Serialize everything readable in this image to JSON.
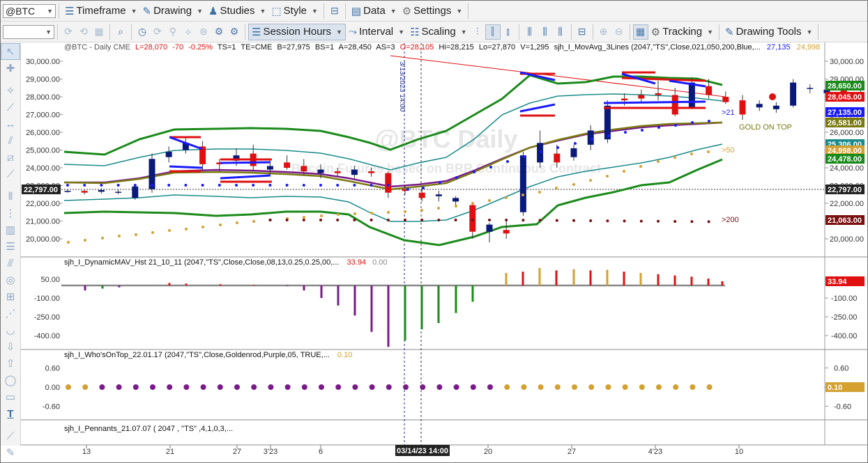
{
  "toolbar1": {
    "symbol": "@BTC",
    "timeframe": "Timeframe",
    "drawing": "Drawing",
    "studies": "Studies",
    "style": "Style",
    "data": "Data",
    "settings": "Settings"
  },
  "toolbar2": {
    "session_hours": "Session Hours",
    "interval": "Interval",
    "scaling": "Scaling",
    "tracking": "Tracking",
    "drawing_tools": "Drawing Tools"
  },
  "header": {
    "symbol_info": "@BTC - Daily  CME",
    "last": "L=28,070",
    "change": "-70",
    "pct": "-0.25%",
    "ts": "TS=1",
    "te": "TE=CME",
    "bid": "B=27,975",
    "bs": "BS=1",
    "ask": "A=28,450",
    "as": "AS=3",
    "open": "O=28,105",
    "hi": "Hi=28,215",
    "lo": "Lo=27,870",
    "vol": "V=1,295",
    "study": "sjh_I_MovAvg_3Lines (2047,\"TS\",Close,021,050,200,Blue,...",
    "val1": "27,135",
    "val2": "24,998"
  },
  "watermark": {
    "title": "@BTC Daily",
    "subtitle": "Bitcoin Futures based on BRR Continuous Contract"
  },
  "colors": {
    "up": "#0a1a7a",
    "down": "#e01010",
    "green": "#1a8a1a",
    "teal": "#1a8a8a",
    "purple": "#7a1a8a",
    "gold": "#d4a030",
    "darkred": "#7a1010",
    "blue": "#1a1aff",
    "olive": "#7a7a10"
  },
  "price_axis": {
    "ticks": [
      "30,000.00",
      "29,000.00",
      "28,000.00",
      "27,000.00",
      "26,000.00",
      "25,000.00",
      "24,000.00",
      "23,000.00",
      "22,000.00",
      "21,000.00",
      "20,000.00"
    ],
    "left_label": "22,797.00",
    "badges": [
      {
        "text": "28,650.00",
        "color": "#1a8a1a"
      },
      {
        "text": "28,045.00",
        "color": "#e01010"
      },
      {
        "text": "27,135.00",
        "color": "#1a1aff"
      },
      {
        "text": "26,581.00",
        "color": "#7a7a10"
      },
      {
        "text": "25,306.00",
        "color": "#1a8a8a"
      },
      {
        "text": "24,998.00",
        "color": "#d4a030"
      },
      {
        "text": "24,478.00",
        "color": "#1a8a1a"
      },
      {
        "text": "22,797.00",
        "color": "#222222"
      },
      {
        "text": "21,063.00",
        "color": "#7a1010"
      }
    ]
  },
  "labels": {
    "ma21": ">21",
    "ma50": ">50",
    "ma200": ">200",
    "gold_on_top": "GOLD ON TOP",
    "vline_date": "3/13/2023 14:00"
  },
  "panel2": {
    "title": "sjh_I_DynamicMAV_Hst 21_10_11 (2047,\"TS\",Close,Close,08,13,0.25,0.25,00,...",
    "v1": "33.94",
    "v2": "0.00",
    "ticks": [
      "50.00",
      "-100.00",
      "-250.00",
      "-400.00"
    ],
    "badge": "33.94"
  },
  "panel3": {
    "title": "sjh_I_Who'sOnTop_22.01.17 (2047,\"TS\",Close,Goldenrod,Purple,05, TRUE,...",
    "v1": "0.10",
    "ticks": [
      "0.60",
      "0.00",
      "-0.60"
    ],
    "badge": "0.10"
  },
  "panel4": {
    "title": "sjh_I_Pennants_21.07.07 ( 2047 , \"TS\" ,4,1,0,3,..."
  },
  "time_axis": {
    "labels": [
      "13",
      "21",
      "27",
      "3'23",
      "6",
      "20",
      "27",
      "4'23",
      "10"
    ],
    "cursor": "03/14/23 14:00"
  }
}
